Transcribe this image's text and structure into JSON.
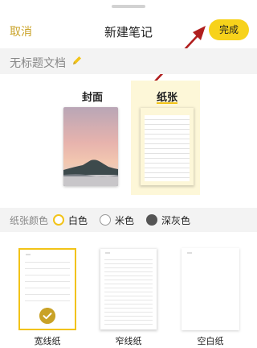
{
  "header": {
    "cancel_label": "取消",
    "title": "新建笔记",
    "done_label": "完成"
  },
  "document": {
    "name": "无标题文档",
    "edit_icon": "pencil-icon"
  },
  "style_tabs": [
    {
      "label": "封面",
      "selected": false
    },
    {
      "label": "纸张",
      "selected": true
    }
  ],
  "paper_color": {
    "title": "纸张颜色",
    "options": [
      {
        "label": "白色",
        "selected": true
      },
      {
        "label": "米色",
        "selected": false
      },
      {
        "label": "深灰色",
        "selected": false
      }
    ]
  },
  "paper_types": [
    {
      "label": "宽线纸",
      "selected": true
    },
    {
      "label": "窄线纸",
      "selected": false
    },
    {
      "label": "空白纸",
      "selected": false
    }
  ],
  "colors": {
    "accent": "#f7d21b",
    "accent_text": "#c9a227",
    "annotation_arrow": "#b01e1e"
  }
}
